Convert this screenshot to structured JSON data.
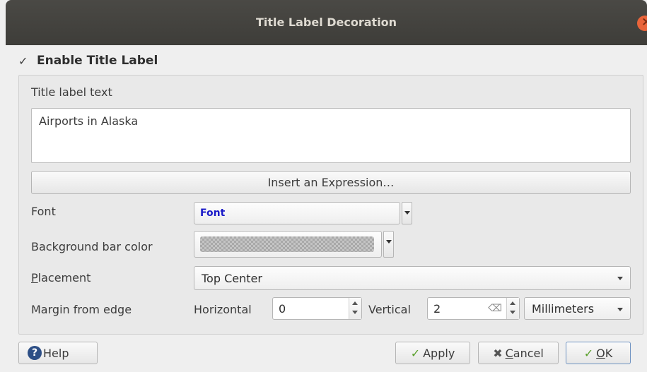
{
  "window": {
    "title": "Title Label Decoration"
  },
  "enable": {
    "label": "Enable Title Label",
    "checked": true,
    "check_glyph": "✓"
  },
  "title_text": {
    "label": "Title label text",
    "value": "Airports in Alaska"
  },
  "insert_expression": {
    "label": "Insert an Expression…"
  },
  "font": {
    "label": "Font",
    "button_text": "Font",
    "sample_color": "#1a1ac8"
  },
  "bg_color": {
    "label": "Background bar color",
    "swatch": "transparent-checkerboard"
  },
  "placement": {
    "label_prefix": "P",
    "label_rest": "lacement",
    "value": "Top Center"
  },
  "margin": {
    "label": "Margin from edge",
    "horizontal_label": "Horizontal",
    "horizontal_value": "0",
    "vertical_label": "Vertical",
    "vertical_value": "2",
    "units": "Millimeters"
  },
  "buttons": {
    "help": "Help",
    "apply": "Apply",
    "cancel_prefix": "C",
    "cancel_rest": "ancel",
    "ok_prefix": "O",
    "ok_rest": "K"
  },
  "icons": {
    "close": "close-icon",
    "help": "help-icon",
    "apply": "checkmark-icon",
    "cancel": "x-icon",
    "ok": "checkmark-icon"
  }
}
